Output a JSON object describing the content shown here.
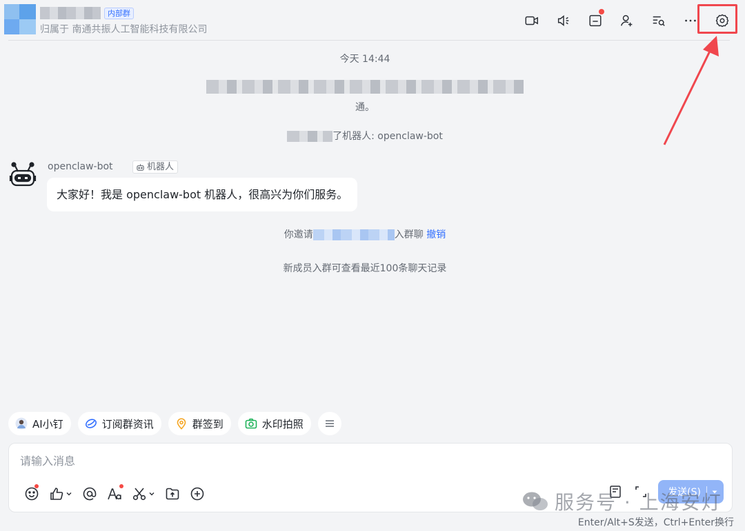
{
  "header": {
    "tag": "内部群",
    "org": "归属于 南通共振人工智能科技有限公司",
    "icons": [
      "video-call-icon",
      "voice-icon",
      "notice-icon",
      "add-member-icon",
      "search-history-icon",
      "more-icon",
      "settings-icon"
    ]
  },
  "chat": {
    "time": "今天 14:44",
    "notice_tail": "通。",
    "added_bot": "了机器人: openclaw-bot",
    "bot_name": "openclaw-bot",
    "bot_tag": "机器人",
    "bot_message": "大家好！我是 openclaw-bot 机器人，很高兴为你们服务。",
    "invite_prefix": "你邀请",
    "invite_suffix": "入群聊",
    "revoke": "撤销",
    "history_notice": "新成员入群可查看最近100条聊天记录"
  },
  "quick_actions": [
    {
      "label": "AI小钉",
      "icon": "ai-avatar-icon"
    },
    {
      "label": "订阅群资讯",
      "icon": "subscribe-icon"
    },
    {
      "label": "群签到",
      "icon": "checkin-icon"
    },
    {
      "label": "水印拍照",
      "icon": "camera-icon"
    }
  ],
  "composer": {
    "placeholder": "请输入消息",
    "send_label": "发送(S)",
    "hint": "Enter/Alt+S发送，Ctrl+Enter换行"
  },
  "watermark": "服务号 · 上海安灯",
  "colors": {
    "accent": "#3370ff",
    "annotation_red": "#f0474e",
    "badge_red": "#f54a45"
  }
}
